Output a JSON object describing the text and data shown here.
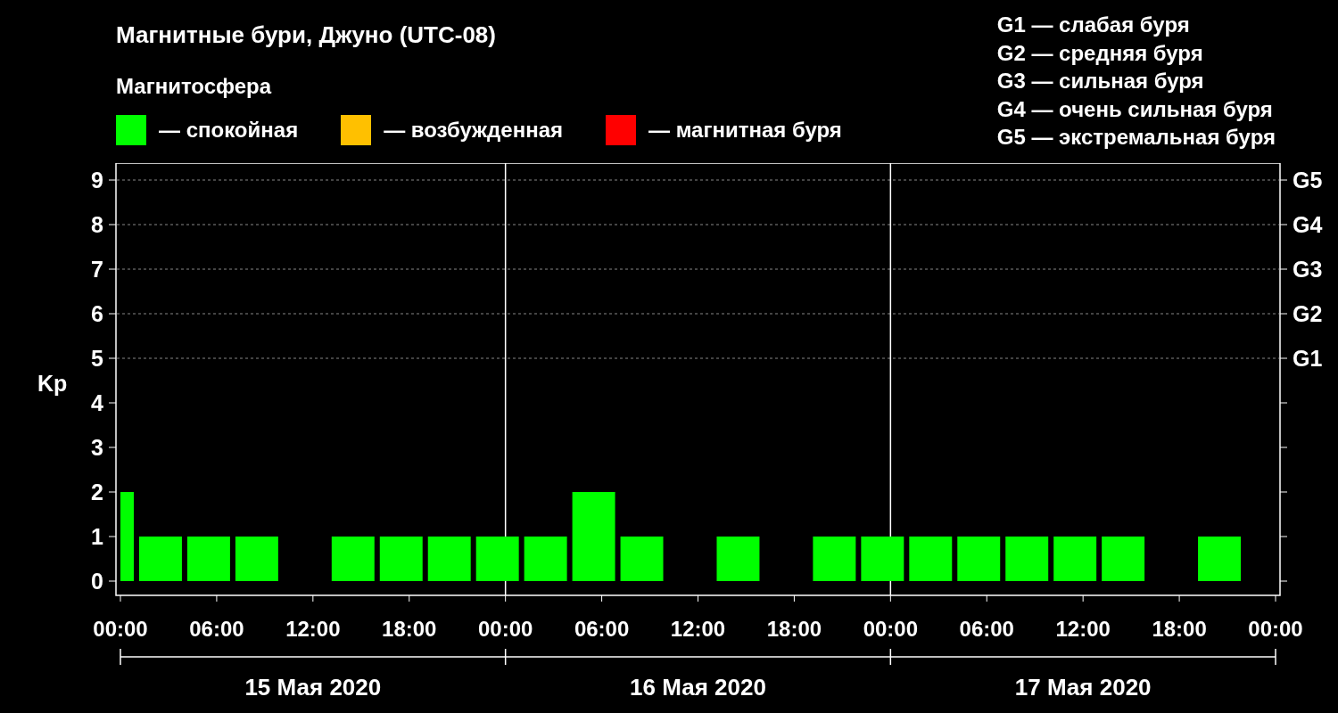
{
  "title": "Магнитные бури, Джуно (UTC-08)",
  "legend": {
    "title": "Магнитосфера",
    "items": [
      {
        "label": "— спокойная",
        "color": "#00ff00"
      },
      {
        "label": "— возбужденная",
        "color": "#ffc000"
      },
      {
        "label": "— магнитная буря",
        "color": "#ff0000"
      }
    ]
  },
  "g_scale": [
    "G1 — слабая буря",
    "G2 — средняя буря",
    "G3 — сильная буря",
    "G4 — очень сильная буря",
    "G5 — экстремальная буря"
  ],
  "chart": {
    "right_axis_labels": [
      "G5",
      "G4",
      "G3",
      "G2",
      "G1"
    ],
    "day_labels": [
      "15 Мая 2020",
      "16 Мая 2020",
      "17 Мая 2020"
    ],
    "chart_data": {
      "type": "bar",
      "ylabel": "Kp",
      "grid": true,
      "x": [
        "2020-05-15 00:30",
        "2020-05-15 02:30",
        "2020-05-15 05:30",
        "2020-05-15 08:30",
        "2020-05-15 14:30",
        "2020-05-15 17:30",
        "2020-05-15 20:30",
        "2020-05-15 23:30",
        "2020-05-16 02:30",
        "2020-05-16 05:30",
        "2020-05-16 08:30",
        "2020-05-16 14:30",
        "2020-05-16 20:30",
        "2020-05-16 23:30",
        "2020-05-17 02:30",
        "2020-05-17 05:30",
        "2020-05-17 08:30",
        "2020-05-17 11:30",
        "2020-05-17 14:30",
        "2020-05-17 20:30"
      ],
      "series": [
        {
          "values": [
            2,
            1,
            1,
            1,
            1,
            1,
            1,
            1,
            1,
            2,
            1,
            1,
            1,
            1,
            1,
            1,
            1,
            1,
            1,
            1
          ]
        }
      ],
      "xlim": [
        "2020-05-15 00:00",
        "2020-05-18 00:00"
      ],
      "ylim": [
        -0.32,
        9.38
      ],
      "yticks": [
        0,
        1,
        2,
        3,
        4,
        5,
        6,
        7,
        8,
        9
      ],
      "xticks": [
        {
          "value": "2020-05-15 00:00",
          "label": "00:00"
        },
        {
          "value": "2020-05-15 06:00",
          "label": "06:00"
        },
        {
          "value": "2020-05-15 12:00",
          "label": "12:00"
        },
        {
          "value": "2020-05-15 18:00",
          "label": "18:00"
        },
        {
          "value": "2020-05-16 00:00",
          "label": "00:00"
        },
        {
          "value": "2020-05-16 06:00",
          "label": "06:00"
        },
        {
          "value": "2020-05-16 12:00",
          "label": "12:00"
        },
        {
          "value": "2020-05-16 18:00",
          "label": "18:00"
        },
        {
          "value": "2020-05-17 00:00",
          "label": "00:00"
        },
        {
          "value": "2020-05-17 06:00",
          "label": "06:00"
        },
        {
          "value": "2020-05-17 12:00",
          "label": "12:00"
        },
        {
          "value": "2020-05-17 18:00",
          "label": "18:00"
        },
        {
          "value": "2020-05-18 00:00",
          "label": "00:00"
        }
      ]
    }
  }
}
